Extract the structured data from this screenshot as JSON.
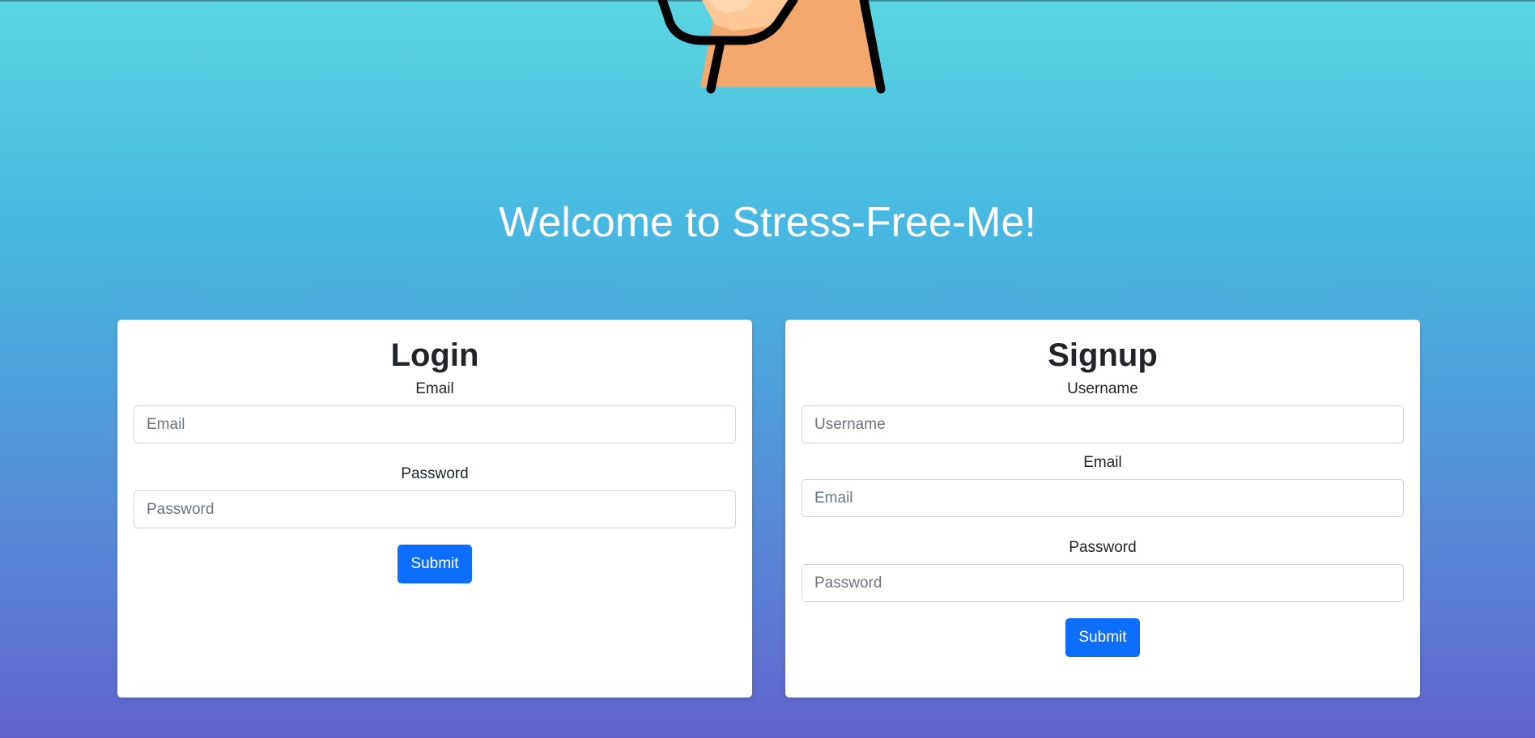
{
  "header": {
    "welcome_text": "Welcome to Stress-Free-Me!"
  },
  "login": {
    "title": "Login",
    "email_label": "Email",
    "email_placeholder": "Email",
    "email_value": "",
    "password_label": "Password",
    "password_placeholder": "Password",
    "password_value": "",
    "submit_label": "Submit"
  },
  "signup": {
    "title": "Signup",
    "username_label": "Username",
    "username_placeholder": "Username",
    "username_value": "",
    "email_label": "Email",
    "email_placeholder": "Email",
    "email_value": "",
    "password_label": "Password",
    "password_placeholder": "Password",
    "password_value": "",
    "submit_label": "Submit"
  },
  "colors": {
    "accent": "#0d6efd",
    "background_top": "#5ad6e0",
    "background_bottom": "#6362cc",
    "mascot_skin": "#f5a86e",
    "mascot_skin_light": "#ffc793"
  },
  "icons": {
    "mascot": "mascot-illustration"
  }
}
